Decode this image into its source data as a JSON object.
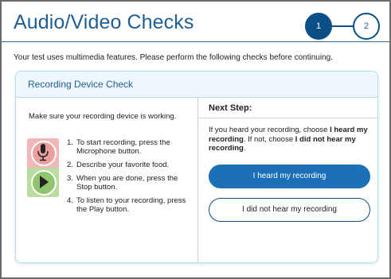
{
  "header": {
    "title": "Audio/Video Checks"
  },
  "stepper": {
    "steps": [
      "1",
      "2"
    ],
    "active": 1
  },
  "intro_text": "Your test uses multimedia features. Please perform the following checks before continuing.",
  "card": {
    "title": "Recording Device Check",
    "left": {
      "intro": "Make sure your recording device is working.",
      "controls": [
        "microphone-icon",
        "play-icon"
      ],
      "instructions": [
        {
          "num": "1.",
          "text": "To start recording, press the Microphone button."
        },
        {
          "num": "2.",
          "text": "Describe your favorite food."
        },
        {
          "num": "3.",
          "text": "When you are done, press the Stop button."
        },
        {
          "num": "4.",
          "text": "To listen to your recording, press the Play button."
        }
      ]
    },
    "right": {
      "title": "Next Step:",
      "desc_part1": "If you heard your recording, choose ",
      "desc_bold1": "I heard my recording",
      "desc_part2": ". If not, choose ",
      "desc_bold2": "I did not hear my recording",
      "desc_part3": ".",
      "primary_button": "I heard my recording",
      "secondary_button": "I did not hear my recording"
    }
  },
  "colors": {
    "title_blue": "#1f5f96",
    "step_navy": "#0c4f86",
    "button_blue": "#1b70b6",
    "mic_bg": "#f2b8b8",
    "play_bg": "#b9dda0"
  }
}
